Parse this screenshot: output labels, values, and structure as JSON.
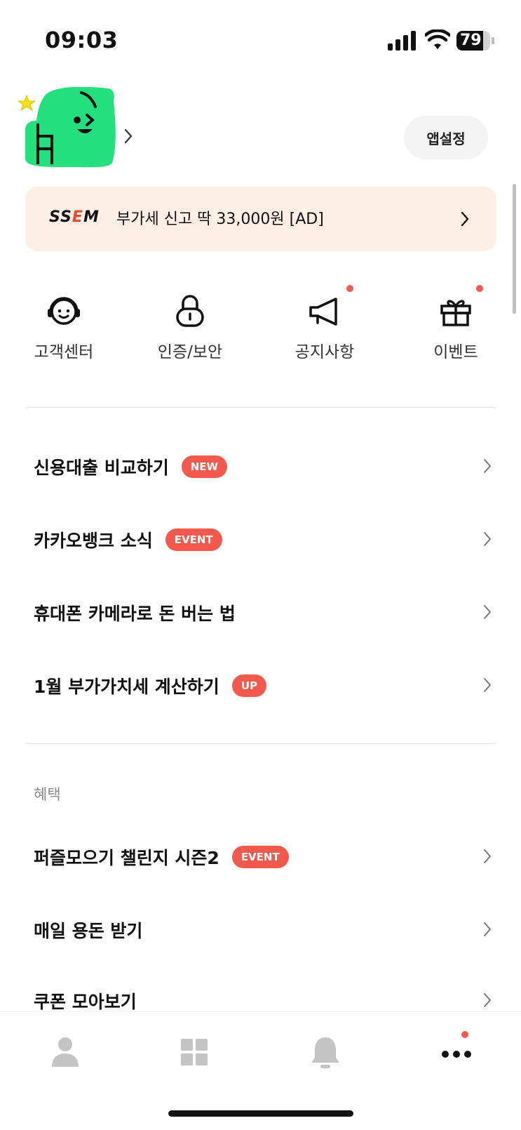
{
  "status_bar": {
    "time": "09:03",
    "battery_percent": 79,
    "battery_label": "79"
  },
  "header": {
    "settings_label": "앱설정"
  },
  "ad_banner": {
    "brand_prefix": "SS",
    "brand_accent": "E",
    "brand_suffix": "M",
    "text": "부가세 신고 딱 33,000원 [AD]"
  },
  "quick_menu": [
    {
      "label": "고객센터",
      "icon": "support-headset-icon",
      "has_dot": false
    },
    {
      "label": "인증/보안",
      "icon": "lock-icon",
      "has_dot": false
    },
    {
      "label": "공지사항",
      "icon": "megaphone-icon",
      "has_dot": true
    },
    {
      "label": "이벤트",
      "icon": "gift-icon",
      "has_dot": true
    }
  ],
  "menu_items": [
    {
      "label": "신용대출 비교하기",
      "badge": "NEW"
    },
    {
      "label": "카카오뱅크 소식",
      "badge": "EVENT"
    },
    {
      "label": "휴대폰 카메라로 돈 버는 법",
      "badge": ""
    },
    {
      "label": "1월 부가가치세 계산하기",
      "badge": "UP"
    }
  ],
  "benefits": {
    "title": "혜택",
    "items": [
      {
        "label": "퍼즐모으기 챌린지 시즌2",
        "badge": "EVENT"
      },
      {
        "label": "매일 용돈 받기",
        "badge": ""
      },
      {
        "label": "쿠폰 모아보기",
        "badge": ""
      }
    ]
  },
  "tab_bar": [
    {
      "icon": "person-icon",
      "active": false
    },
    {
      "icon": "grid-icon",
      "active": false
    },
    {
      "icon": "bell-icon",
      "active": false
    },
    {
      "icon": "more-icon",
      "active": true,
      "has_dot": true
    }
  ],
  "colors": {
    "accent_red": "#f35a4d",
    "banner_bg": "#fdeee6",
    "character_green": "#22e07e"
  }
}
